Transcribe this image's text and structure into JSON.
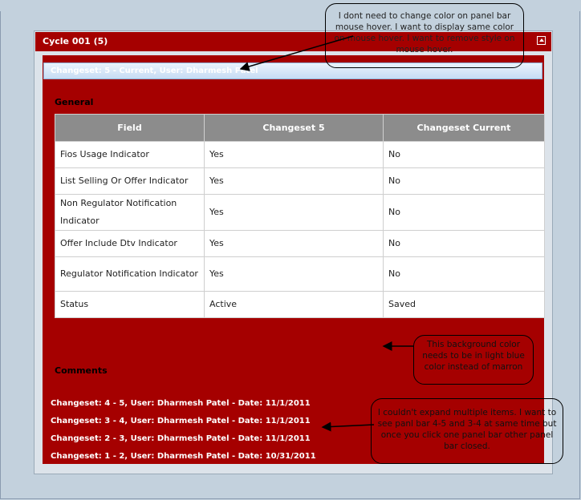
{
  "panel": {
    "title": "Cycle 001 (5)",
    "changeset_header": "Changeset: 5 - Current, User: Dharmesh Patel",
    "general_label": "General",
    "comments_label": "Comments"
  },
  "table": {
    "headers": [
      "Field",
      "Changeset 5",
      "Changeset Current"
    ],
    "rows": [
      [
        "Fios Usage Indicator",
        "Yes",
        "No"
      ],
      [
        "List Selling Or Offer Indicator",
        "Yes",
        "No"
      ],
      [
        "Non Regulator Notification Indicator",
        "Yes",
        "No"
      ],
      [
        "Offer Include Dtv Indicator",
        "Yes",
        "No"
      ],
      [
        "Regulator Notification Indicator",
        "Yes",
        "No"
      ],
      [
        "Status",
        "Active",
        "Saved"
      ]
    ]
  },
  "comments": [
    "Changeset: 4 - 5, User: Dharmesh Patel - Date: 11/1/2011",
    "Changeset: 3 - 4, User: Dharmesh Patel - Date: 11/1/2011",
    "Changeset: 2 - 3, User: Dharmesh Patel - Date: 11/1/2011",
    "Changeset: 1 - 2, User: Dharmesh Patel - Date: 10/31/2011"
  ],
  "annotations": {
    "hover": "I dont need to change color on panel bar mouse hover. I want to display same color on mouse hover. I want to remove style on mouse hover.",
    "background": "This background color needs to be in light blue color instead of marron",
    "expand": "I couldn't expand multiple items. I want to see panl bar 4-5 and 3-4 at same time but once you click one panel bar other panel bar closed."
  },
  "colors": {
    "panel_red": "#a50000",
    "header_gray": "#8c8c8c",
    "bar_blue": "#c6dcf4"
  }
}
